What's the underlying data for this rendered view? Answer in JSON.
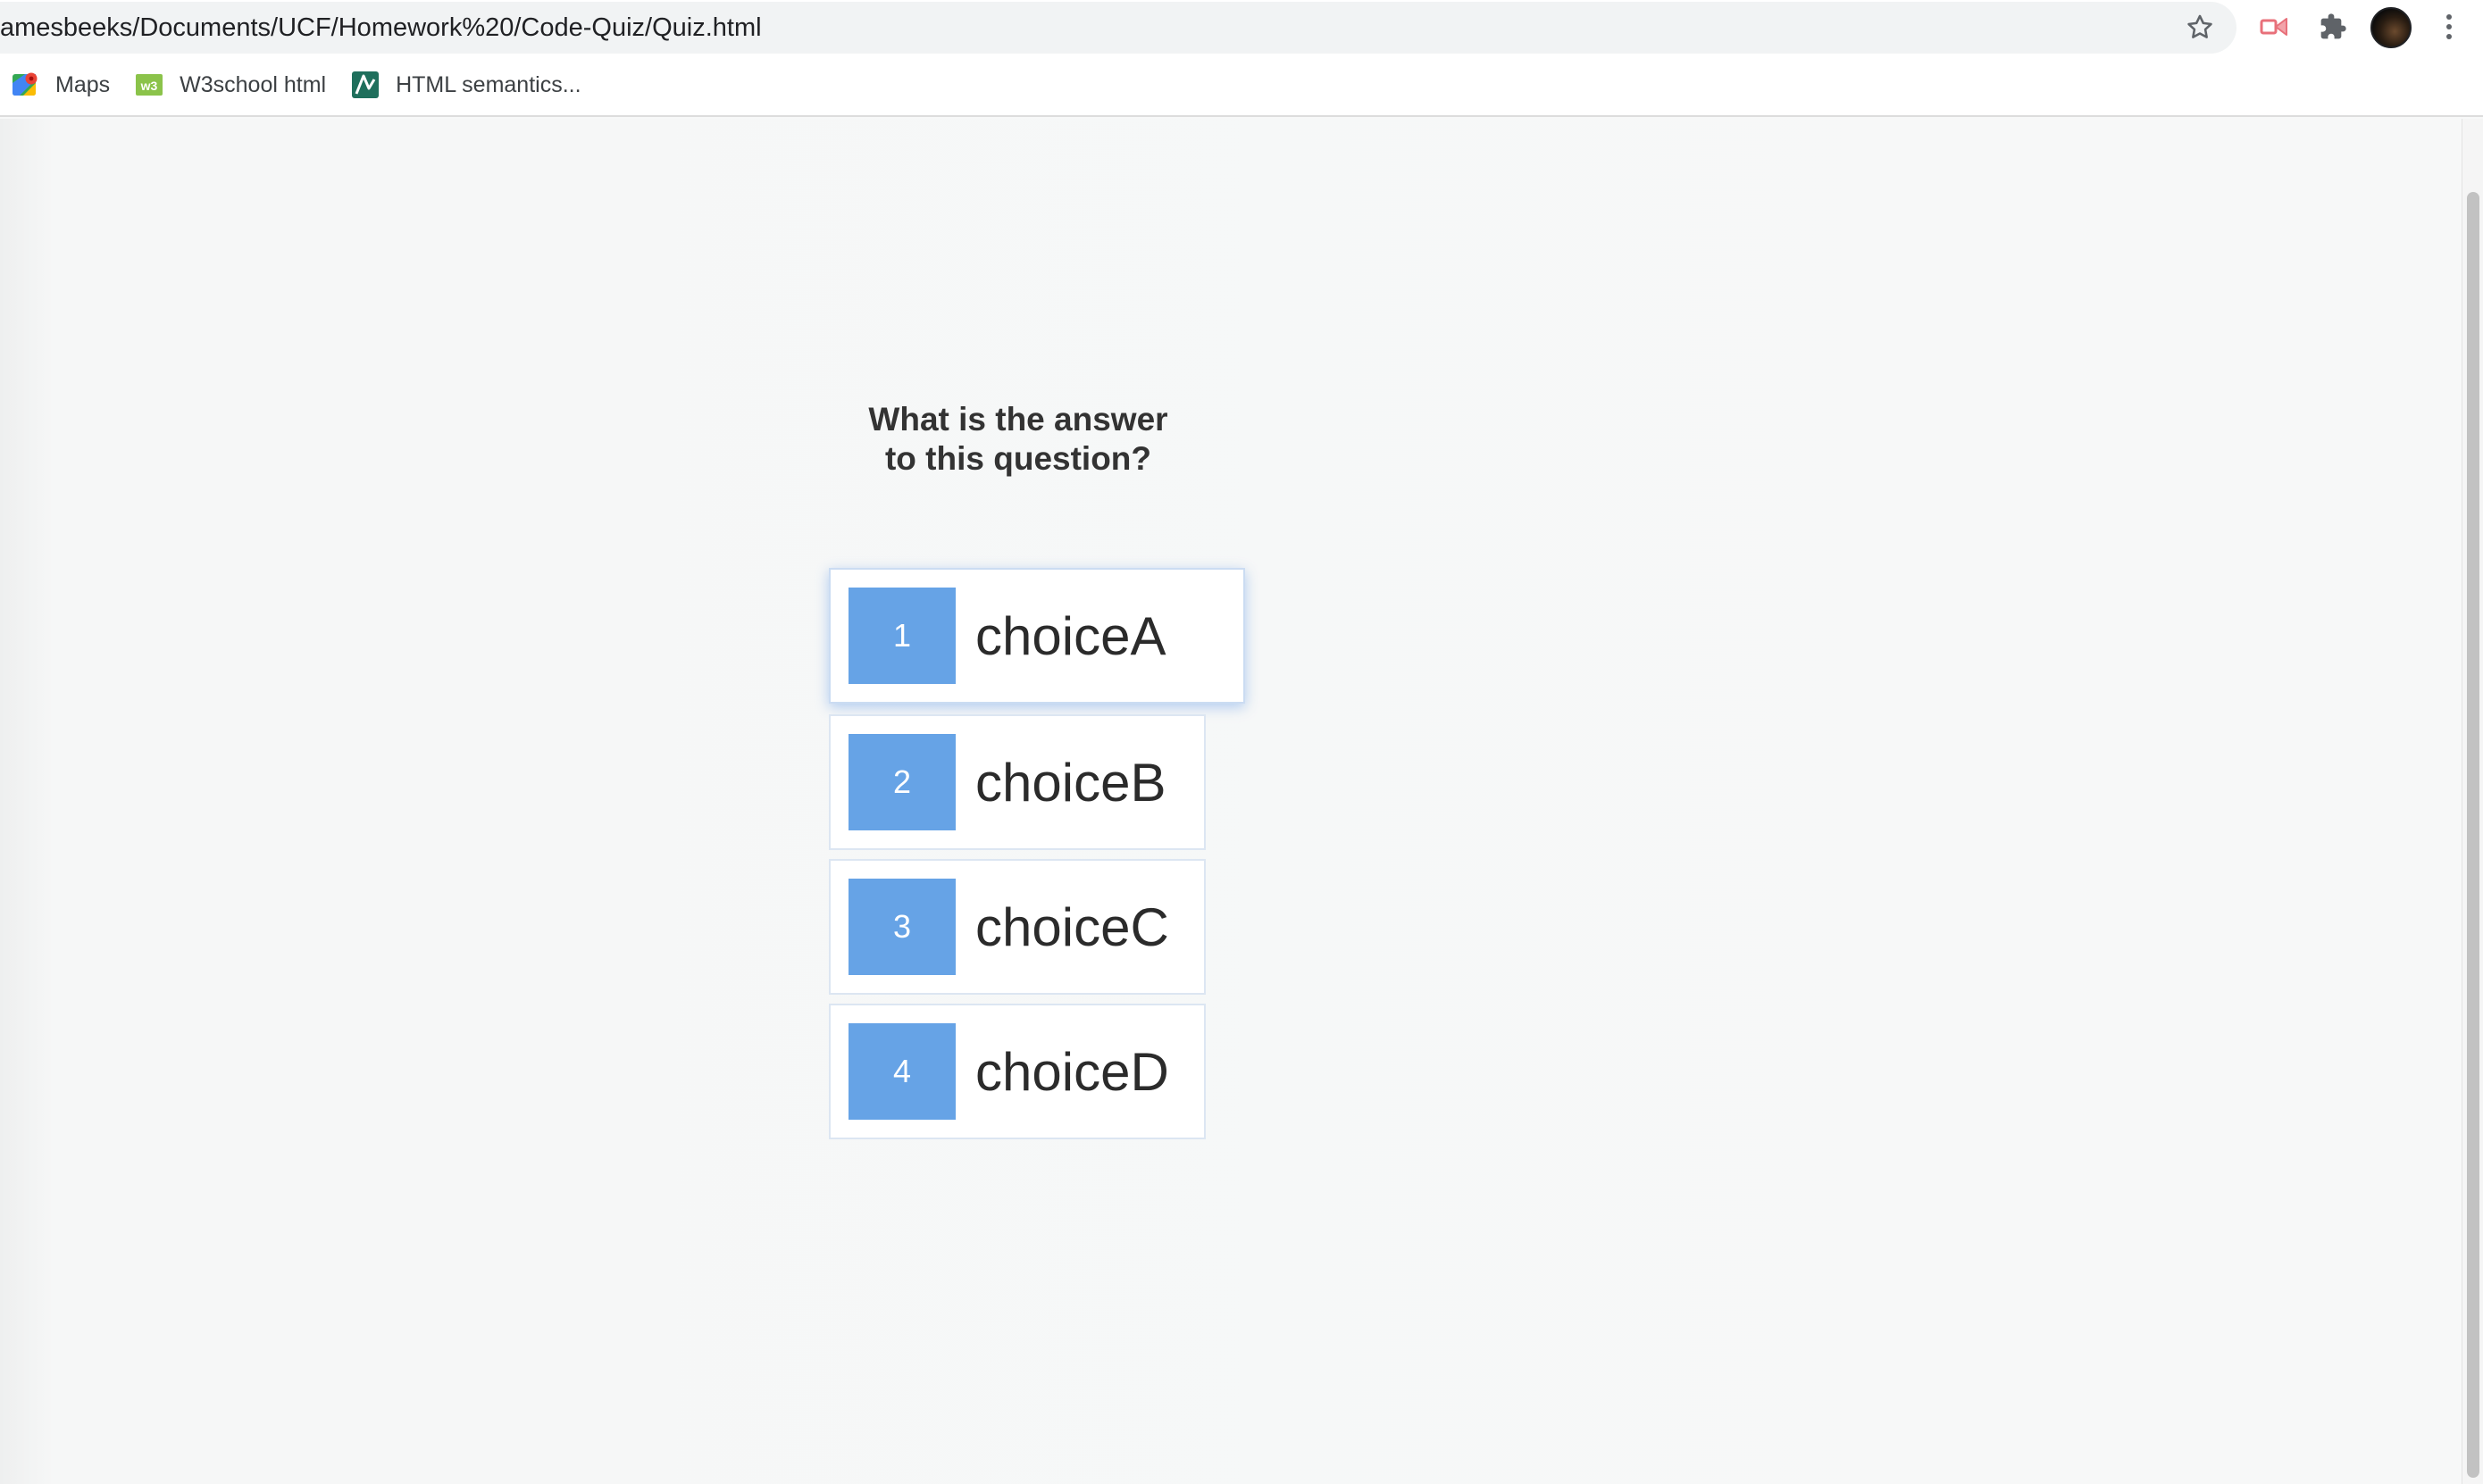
{
  "browser": {
    "url": "amesbeeks/Documents/UCF/Homework%20/Code-Quiz/Quiz.html",
    "bookmarks": [
      {
        "label": "Maps",
        "icon": "google-maps-icon"
      },
      {
        "label": "W3school html",
        "icon": "w3schools-icon"
      },
      {
        "label": "HTML semantics...",
        "icon": "bookmark-site-icon"
      }
    ],
    "toolbar_icons": [
      "star-icon",
      "extension-record-icon",
      "extensions-puzzle-icon",
      "profile-avatar",
      "menu-kebab-icon"
    ]
  },
  "quiz": {
    "question_line1": "What is the answer",
    "question_line2": "to this question?",
    "choices": [
      {
        "number": "1",
        "text": "choiceA"
      },
      {
        "number": "2",
        "text": "choiceB"
      },
      {
        "number": "3",
        "text": "choiceC"
      },
      {
        "number": "4",
        "text": "choiceD"
      }
    ]
  },
  "colors": {
    "choice_prefix": "#66a3e6",
    "page_background": "#f7f8f8",
    "question_text": "#333333"
  }
}
